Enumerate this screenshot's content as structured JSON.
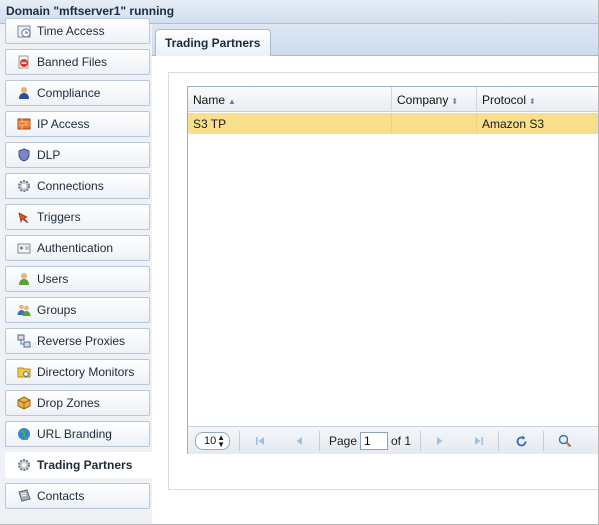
{
  "window": {
    "title": "Domain \"mftserver1\" running"
  },
  "sidebar": {
    "items": [
      {
        "label": "Time Access",
        "icon": "clock-icon"
      },
      {
        "label": "Banned Files",
        "icon": "banned-file-icon"
      },
      {
        "label": "Compliance",
        "icon": "compliance-icon"
      },
      {
        "label": "IP Access",
        "icon": "ip-access-icon"
      },
      {
        "label": "DLP",
        "icon": "shield-icon"
      },
      {
        "label": "Connections",
        "icon": "gear-icon"
      },
      {
        "label": "Triggers",
        "icon": "trigger-icon"
      },
      {
        "label": "Authentication",
        "icon": "id-card-icon"
      },
      {
        "label": "Users",
        "icon": "user-icon"
      },
      {
        "label": "Groups",
        "icon": "group-icon"
      },
      {
        "label": "Reverse Proxies",
        "icon": "network-icon"
      },
      {
        "label": "Directory Monitors",
        "icon": "folder-monitor-icon"
      },
      {
        "label": "Drop Zones",
        "icon": "box-icon"
      },
      {
        "label": "URL Branding",
        "icon": "globe-icon"
      },
      {
        "label": "Trading Partners",
        "icon": "gear-icon"
      },
      {
        "label": "Contacts",
        "icon": "address-book-icon"
      }
    ],
    "selected": "Trading Partners"
  },
  "tabs": [
    {
      "label": "Trading Partners"
    }
  ],
  "grid": {
    "columns": [
      {
        "label": "Name",
        "sort": "ascending"
      },
      {
        "label": "Company",
        "sort": "none"
      },
      {
        "label": "Protocol",
        "sort": "none"
      }
    ],
    "rows": [
      {
        "name": "S3 TP",
        "company": "",
        "protocol": "Amazon S3"
      }
    ]
  },
  "pager": {
    "per_page": "10",
    "page_label": "Page",
    "page_value": "1",
    "of_label": "of 1"
  },
  "colors": {
    "selected_row": "#f9de8b",
    "header_bg": "#d2dfee"
  }
}
